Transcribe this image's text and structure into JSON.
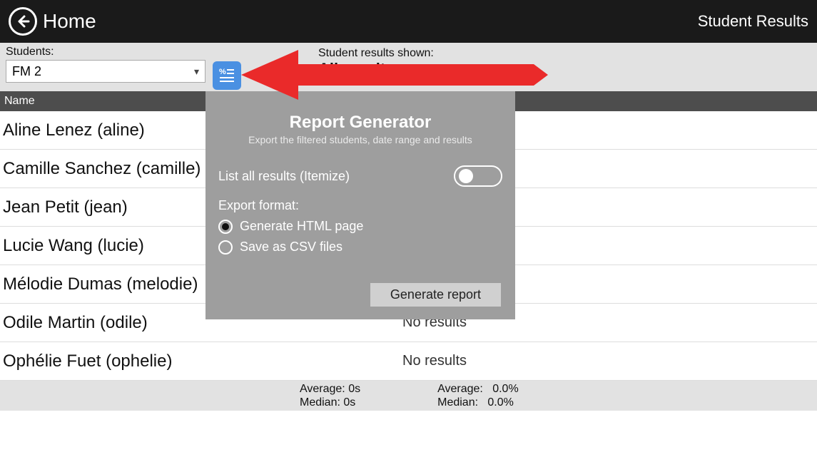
{
  "header": {
    "home_label": "Home",
    "page_title": "Student Results"
  },
  "toolbar": {
    "students_label": "Students:",
    "students_value": "FM 2",
    "results_shown_label": "Student results shown:",
    "results_shown_value": "All results"
  },
  "grid": {
    "name_header": "Name",
    "rows": [
      {
        "name": "Aline Lenez (aline)",
        "result": ""
      },
      {
        "name": "Camille Sanchez (camille)",
        "result": ""
      },
      {
        "name": "Jean Petit (jean)",
        "result": ""
      },
      {
        "name": "Lucie Wang (lucie)",
        "result": ""
      },
      {
        "name": "Mélodie Dumas (melodie)",
        "result": ""
      },
      {
        "name": "Odile Martin (odile)",
        "result": "No results"
      },
      {
        "name": "Ophélie Fuet (ophelie)",
        "result": "No results"
      }
    ]
  },
  "summary": {
    "time_avg_label": "Average:",
    "time_avg_value": "0s",
    "time_med_label": "Median:",
    "time_med_value": "0s",
    "pct_avg_label": "Average:",
    "pct_avg_value": "0.0%",
    "pct_med_label": "Median:",
    "pct_med_value": "0.0%"
  },
  "popup": {
    "title": "Report Generator",
    "subtitle": "Export the filtered students, date range and results",
    "itemize_label": "List all results (Itemize)",
    "itemize_on": false,
    "export_format_label": "Export format:",
    "option_html": "Generate HTML page",
    "option_csv": "Save as CSV files",
    "selected_format": "html",
    "generate_btn": "Generate report"
  },
  "colors": {
    "accent": "#4a90e2",
    "arrow": "#ea2a2a"
  }
}
